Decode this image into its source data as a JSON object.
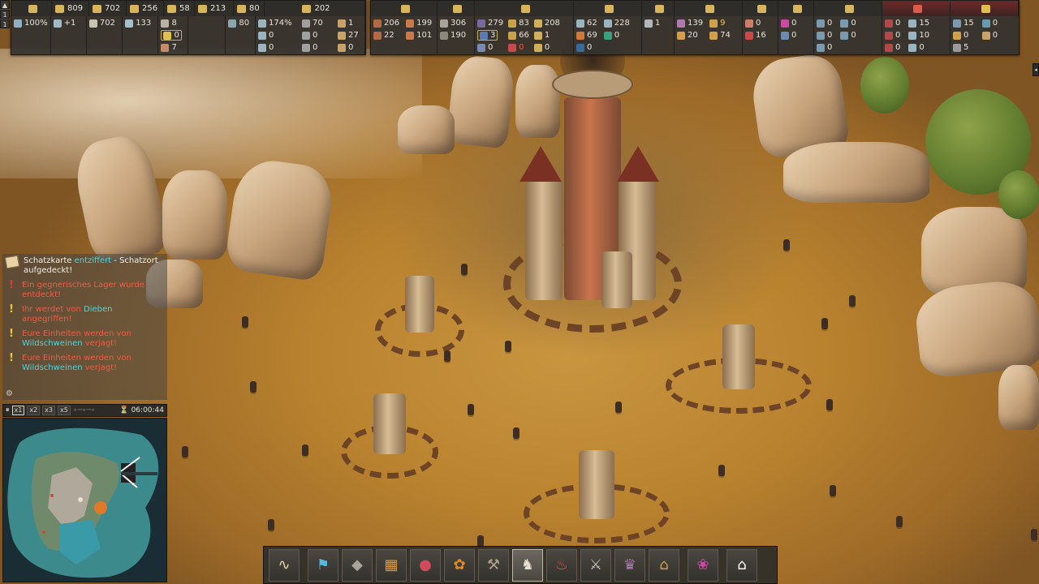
{
  "hud_left": {
    "header": [
      "809",
      "702",
      "256",
      "58",
      "213",
      "80",
      "202"
    ],
    "col_pop": {
      "stats": [
        "100%"
      ]
    },
    "col_a": {
      "rows": [
        "+1"
      ]
    },
    "col_b": {
      "rows": [
        "702"
      ]
    },
    "col_c": {
      "rows": [
        "133"
      ]
    },
    "col_d": {
      "rows": [
        "8",
        "0",
        "7"
      ]
    },
    "col_e": {
      "rows": []
    },
    "col_f": {
      "rows": [
        "80"
      ]
    },
    "col_g": {
      "rows": [
        "174%",
        "0",
        "0"
      ],
      "right": [
        "70",
        "0",
        "0"
      ],
      "far": [
        "1",
        "27",
        "0"
      ]
    }
  },
  "hud_right": {
    "c1": [
      "206",
      "22"
    ],
    "c1b": [
      "199",
      "101"
    ],
    "c2": [
      "306",
      "190"
    ],
    "c3": [
      "279",
      "3",
      "0"
    ],
    "c3b": [
      "83",
      "66",
      "0"
    ],
    "c3c": [
      "208",
      "1",
      "0"
    ],
    "c4": [
      "62",
      "69",
      "0"
    ],
    "c4b": [
      "228",
      "0"
    ],
    "c5": [
      "1"
    ],
    "c6": [
      "139",
      "20"
    ],
    "c6b": [
      "9",
      "74"
    ],
    "c7": [
      "0",
      "16"
    ],
    "c8": [
      "0",
      "0"
    ],
    "c9": [
      "0",
      "0",
      "0"
    ],
    "c9b": [
      "0",
      "0"
    ],
    "c10": [
      "0",
      "0",
      "0"
    ],
    "c10b": [
      "15",
      "10",
      "0"
    ],
    "c11": [
      "15",
      "0",
      "5"
    ],
    "c11b": [
      "0",
      "0"
    ]
  },
  "side_speed": [
    "1",
    "1"
  ],
  "notifications": [
    {
      "kind": "map",
      "parts": [
        {
          "t": "Schatzkarte ",
          "c": "c-white"
        },
        {
          "t": "entziffert",
          "c": "c-cyan"
        },
        {
          "t": " - Schatzort aufgedeckt!",
          "c": "c-white"
        }
      ]
    },
    {
      "kind": "red",
      "parts": [
        {
          "t": "Ein gegnerisches Lager wurde entdeckt!",
          "c": "c-red"
        }
      ]
    },
    {
      "kind": "warn",
      "parts": [
        {
          "t": "Ihr werdet von ",
          "c": "c-red"
        },
        {
          "t": "Dieben",
          "c": "c-cyan"
        },
        {
          "t": " angegriffen!",
          "c": "c-red"
        }
      ]
    },
    {
      "kind": "warn",
      "parts": [
        {
          "t": "Eure Einheiten werden von ",
          "c": "c-red"
        },
        {
          "t": "Wildschweinen",
          "c": "c-cyan"
        },
        {
          "t": " verjagt!",
          "c": "c-red"
        }
      ]
    },
    {
      "kind": "warn",
      "parts": [
        {
          "t": "Eure Einheiten werden von ",
          "c": "c-red"
        },
        {
          "t": "Wildschweinen",
          "c": "c-cyan"
        },
        {
          "t": " verjagt!",
          "c": "c-red"
        }
      ]
    }
  ],
  "minimap": {
    "speeds": [
      "x1",
      "x2",
      "x3",
      "x5"
    ],
    "time": "06:00:44"
  },
  "toolbar": [
    "road-icon",
    "flag-icon",
    "quarry-icon",
    "storage-icon",
    "food-icon",
    "farm-icon",
    "smith-icon",
    "statue-icon",
    "religion-icon",
    "military-icon",
    "academy-icon",
    "market-icon",
    "decoration-icon",
    "home-icon"
  ],
  "colors": {
    "accent": "#c9b04a",
    "alert": "#f05a46",
    "highlight": "#4fd2dc"
  }
}
